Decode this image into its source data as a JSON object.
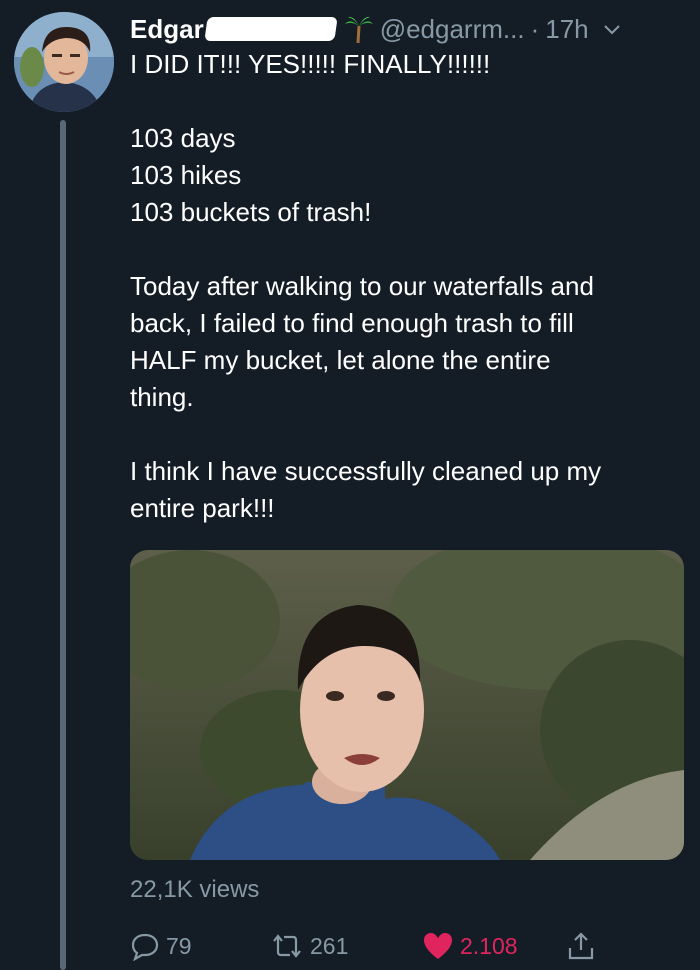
{
  "tweet": {
    "author_name": "Edgar",
    "handle": "@edgarrm...",
    "separator": "·",
    "time": "17h",
    "lines": [
      "I DID IT!!! YES!!!!! FINALLY!!!!!!",
      "",
      "103 days",
      "103 hikes",
      "103 buckets of trash!",
      "",
      "Today after walking to our waterfalls and",
      "back, I failed to find enough trash to fill",
      "HALF my bucket, let alone the entire",
      "thing.",
      "",
      "I think I have successfully cleaned up my",
      "entire park!!!"
    ],
    "views": "22,1K views",
    "reply_count": "79",
    "retweet_count": "261",
    "like_count": "2.108"
  },
  "colors": {
    "background": "#141d26",
    "secondary_text": "#8899a6",
    "like": "#e0245e"
  },
  "icons": {
    "palm": "palm-tree-icon",
    "chevron": "chevron-down-icon",
    "reply": "reply-icon",
    "retweet": "retweet-icon",
    "like": "heart-icon",
    "share": "share-icon"
  }
}
